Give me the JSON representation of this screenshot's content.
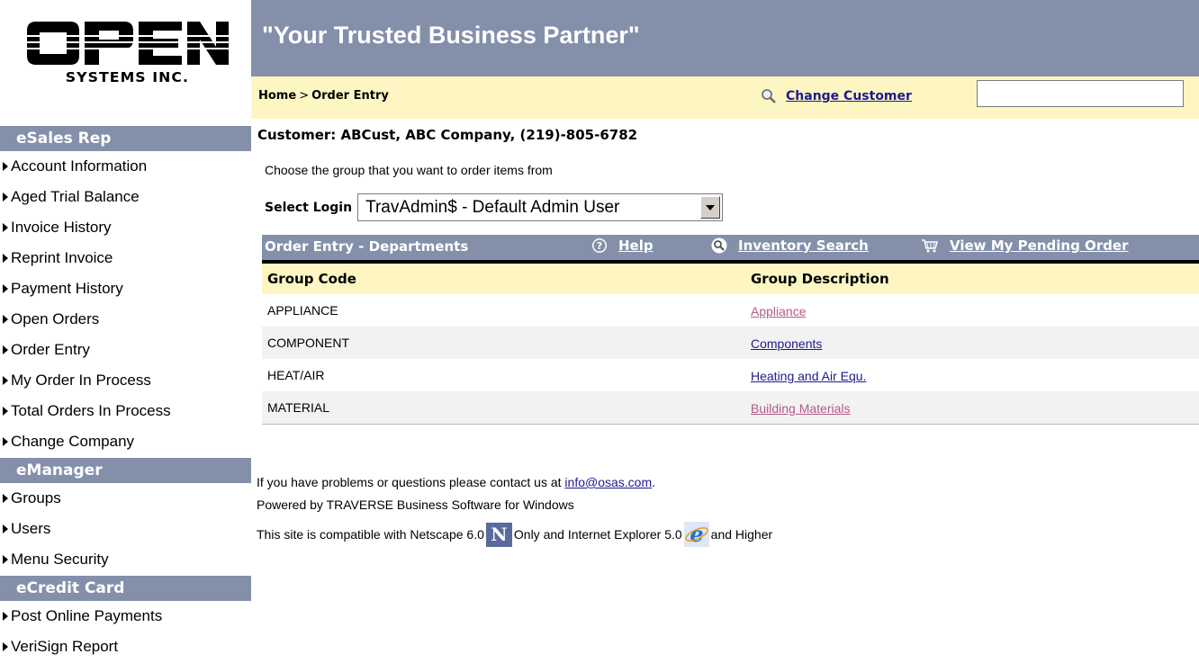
{
  "logo": {
    "main_text": "OPEN",
    "sub_text": "SYSTEMS INC."
  },
  "header": {
    "slogan": "\"Your Trusted Business Partner\"",
    "breadcrumb": {
      "home": "Home",
      "separator": ">",
      "current": "Order Entry"
    },
    "change_customer_label": "Change Customer",
    "customer_input_value": ""
  },
  "sidebar": {
    "sections": [
      {
        "title": "eSales Rep",
        "items": [
          "Account Information",
          "Aged Trial Balance",
          "Invoice History",
          "Reprint Invoice",
          "Payment History",
          "Open Orders",
          "Order Entry",
          "My Order In Process",
          "Total Orders In Process",
          "Change Company"
        ]
      },
      {
        "title": "eManager",
        "items": [
          "Groups",
          "Users",
          "Menu Security"
        ]
      },
      {
        "title": "eCredit Card",
        "items": [
          "Post Online Payments",
          "VeriSign Report"
        ]
      }
    ]
  },
  "main": {
    "customer_line": "Customer: ABCust, ABC Company, (219)-805-6782",
    "instruction": "Choose the group that you want to order items from",
    "select_login_label": "Select Login",
    "select_login_value": "TravAdmin$ - Default Admin User",
    "grid": {
      "title": "Order Entry - Departments",
      "help_label": "Help",
      "inventory_label": "Inventory Search",
      "pending_label": "View My Pending Order",
      "col_code": "Group Code",
      "col_desc": "Group Description",
      "rows": [
        {
          "code": "APPLIANCE",
          "desc": "Appliance",
          "visited": true
        },
        {
          "code": "COMPONENT",
          "desc": "Components",
          "visited": false
        },
        {
          "code": "HEAT/AIR",
          "desc": "Heating and Air Equ.",
          "visited": false
        },
        {
          "code": "MATERIAL",
          "desc": "Building Materials",
          "visited": true
        }
      ]
    },
    "footer": {
      "contact_prefix": "If you have problems or questions please contact us at ",
      "contact_email": "info@osas.com",
      "contact_suffix": ".",
      "powered": "Powered by TRAVERSE Business Software for Windows",
      "compat_a": "This site is compatible with Netscape 6.0",
      "netscape_letter": "N",
      "compat_b": "Only and Internet Explorer 5.0",
      "compat_c": "and Higher"
    }
  },
  "colors": {
    "header_bar": "#8490aa",
    "yellow_bar": "#fdf6c3",
    "link": "#1f1a8c",
    "visited_link": "#b25a8a"
  },
  "icons": {
    "search": "magnifier-icon",
    "help": "help-circle-icon",
    "cart": "cart-icon",
    "ie": "ie-logo-icon",
    "netscape": "netscape-logo-icon"
  }
}
